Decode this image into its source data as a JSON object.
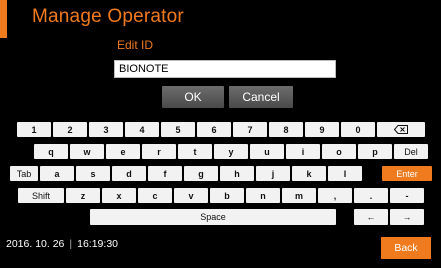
{
  "header": {
    "title": "Manage Operator",
    "subtitle": "Edit ID"
  },
  "id_field": {
    "value": "BIONOTE"
  },
  "buttons": {
    "ok": "OK",
    "cancel": "Cancel",
    "back": "Back"
  },
  "keyboard": {
    "row1": [
      "1",
      "2",
      "3",
      "4",
      "5",
      "6",
      "7",
      "8",
      "9",
      "0"
    ],
    "backspace_icon": "backspace-icon",
    "row2": [
      "q",
      "w",
      "e",
      "r",
      "t",
      "y",
      "u",
      "i",
      "o",
      "p"
    ],
    "row2_extra": "Del",
    "row3_lead": "Tab",
    "row3": [
      "a",
      "s",
      "d",
      "f",
      "g",
      "h",
      "j",
      "k",
      "l"
    ],
    "enter": "Enter",
    "row4_lead": "Shift",
    "row4": [
      "z",
      "x",
      "c",
      "v",
      "b",
      "n",
      "m",
      ",",
      ".",
      "-"
    ],
    "space": "Space",
    "arrow_left": "←",
    "arrow_right": "→"
  },
  "footer": {
    "date": "2016. 10. 26",
    "separator": "|",
    "time": "16:19:30"
  },
  "colors": {
    "accent": "#f07a1e",
    "background": "#000000",
    "key": "#f2f2f2",
    "button_gray": "#5a5a5a"
  }
}
